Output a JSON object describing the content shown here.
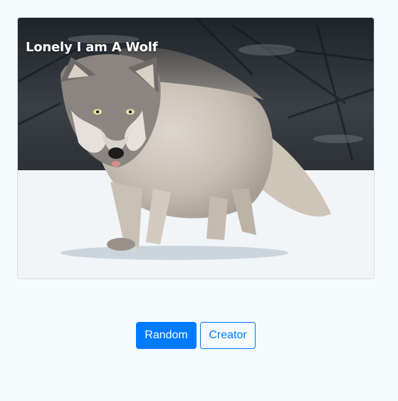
{
  "card": {
    "title": "Lonely I am A Wolf",
    "image_subject": "gray-wolf-walking-in-snow"
  },
  "buttons": {
    "random_label": "Random",
    "creator_label": "Creator"
  },
  "colors": {
    "background": "#f5fbfd",
    "primary": "#007bff",
    "title_text": "#ffffff"
  }
}
